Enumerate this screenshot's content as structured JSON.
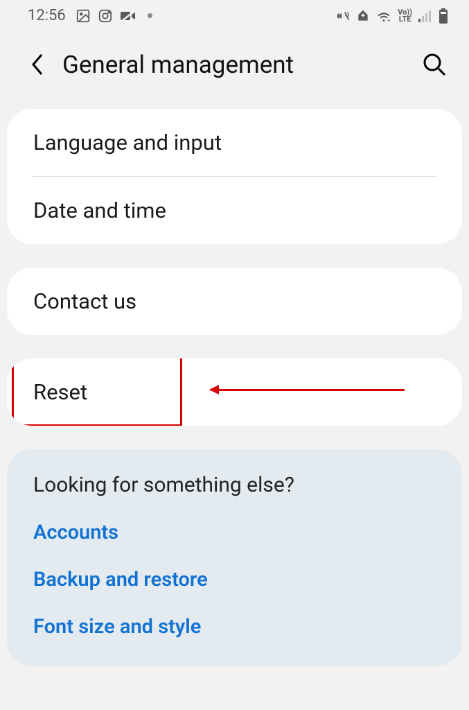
{
  "status": {
    "time": "12:56"
  },
  "header": {
    "title": "General management"
  },
  "group1": {
    "items": [
      "Language and input",
      "Date and time"
    ]
  },
  "group2": {
    "items": [
      "Contact us"
    ]
  },
  "group3": {
    "items": [
      "Reset"
    ]
  },
  "suggestions": {
    "title": "Looking for something else?",
    "links": [
      "Accounts",
      "Backup and restore",
      "Font size and style"
    ]
  }
}
